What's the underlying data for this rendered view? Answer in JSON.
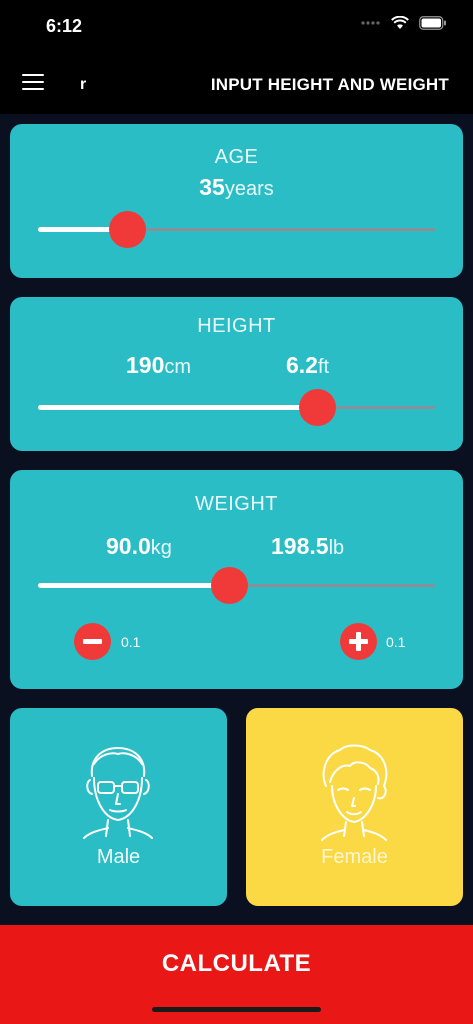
{
  "status_bar": {
    "time": "6:12"
  },
  "nav": {
    "glyph": "r",
    "title": "INPUT HEIGHT AND WEIGHT"
  },
  "age": {
    "title": "AGE",
    "value": "35",
    "unit": "years",
    "slider_fraction": 0.224
  },
  "height": {
    "title": "HEIGHT",
    "cm_value": "190",
    "cm_unit": "cm",
    "ft_value": "6.2",
    "ft_unit": "ft",
    "slider_fraction": 0.703
  },
  "weight": {
    "title": "WEIGHT",
    "kg_value": "90.0",
    "kg_unit": "kg",
    "lb_value": "198.5",
    "lb_unit": "lb",
    "slider_fraction": 0.48,
    "decrement_step": "0.1",
    "increment_step": "0.1"
  },
  "gender": {
    "male_label": "Male",
    "female_label": "Female",
    "selected": "female"
  },
  "actions": {
    "calculate_label": "CALCULATE"
  },
  "colors": {
    "card": "#2bbdc5",
    "accent_red": "#f03a3a",
    "calculate_red": "#ea1717",
    "selected_yellow": "#fbd944",
    "background": "#0b1020"
  }
}
